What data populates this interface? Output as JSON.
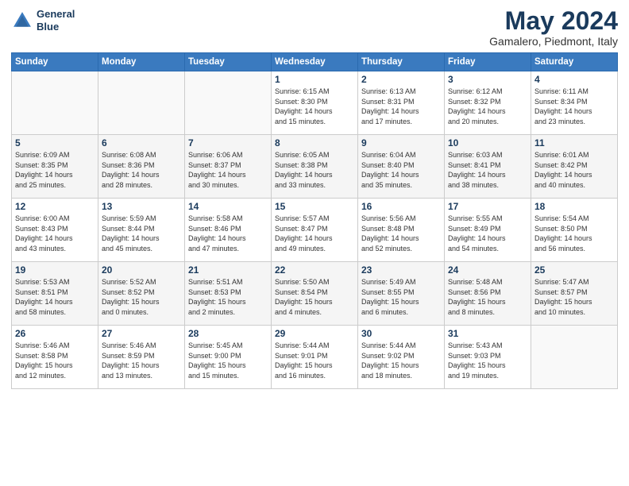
{
  "header": {
    "logo_line1": "General",
    "logo_line2": "Blue",
    "month_title": "May 2024",
    "subtitle": "Gamalero, Piedmont, Italy"
  },
  "weekdays": [
    "Sunday",
    "Monday",
    "Tuesday",
    "Wednesday",
    "Thursday",
    "Friday",
    "Saturday"
  ],
  "weeks": [
    [
      {
        "day": "",
        "info": ""
      },
      {
        "day": "",
        "info": ""
      },
      {
        "day": "",
        "info": ""
      },
      {
        "day": "1",
        "info": "Sunrise: 6:15 AM\nSunset: 8:30 PM\nDaylight: 14 hours\nand 15 minutes."
      },
      {
        "day": "2",
        "info": "Sunrise: 6:13 AM\nSunset: 8:31 PM\nDaylight: 14 hours\nand 17 minutes."
      },
      {
        "day": "3",
        "info": "Sunrise: 6:12 AM\nSunset: 8:32 PM\nDaylight: 14 hours\nand 20 minutes."
      },
      {
        "day": "4",
        "info": "Sunrise: 6:11 AM\nSunset: 8:34 PM\nDaylight: 14 hours\nand 23 minutes."
      }
    ],
    [
      {
        "day": "5",
        "info": "Sunrise: 6:09 AM\nSunset: 8:35 PM\nDaylight: 14 hours\nand 25 minutes."
      },
      {
        "day": "6",
        "info": "Sunrise: 6:08 AM\nSunset: 8:36 PM\nDaylight: 14 hours\nand 28 minutes."
      },
      {
        "day": "7",
        "info": "Sunrise: 6:06 AM\nSunset: 8:37 PM\nDaylight: 14 hours\nand 30 minutes."
      },
      {
        "day": "8",
        "info": "Sunrise: 6:05 AM\nSunset: 8:38 PM\nDaylight: 14 hours\nand 33 minutes."
      },
      {
        "day": "9",
        "info": "Sunrise: 6:04 AM\nSunset: 8:40 PM\nDaylight: 14 hours\nand 35 minutes."
      },
      {
        "day": "10",
        "info": "Sunrise: 6:03 AM\nSunset: 8:41 PM\nDaylight: 14 hours\nand 38 minutes."
      },
      {
        "day": "11",
        "info": "Sunrise: 6:01 AM\nSunset: 8:42 PM\nDaylight: 14 hours\nand 40 minutes."
      }
    ],
    [
      {
        "day": "12",
        "info": "Sunrise: 6:00 AM\nSunset: 8:43 PM\nDaylight: 14 hours\nand 43 minutes."
      },
      {
        "day": "13",
        "info": "Sunrise: 5:59 AM\nSunset: 8:44 PM\nDaylight: 14 hours\nand 45 minutes."
      },
      {
        "day": "14",
        "info": "Sunrise: 5:58 AM\nSunset: 8:46 PM\nDaylight: 14 hours\nand 47 minutes."
      },
      {
        "day": "15",
        "info": "Sunrise: 5:57 AM\nSunset: 8:47 PM\nDaylight: 14 hours\nand 49 minutes."
      },
      {
        "day": "16",
        "info": "Sunrise: 5:56 AM\nSunset: 8:48 PM\nDaylight: 14 hours\nand 52 minutes."
      },
      {
        "day": "17",
        "info": "Sunrise: 5:55 AM\nSunset: 8:49 PM\nDaylight: 14 hours\nand 54 minutes."
      },
      {
        "day": "18",
        "info": "Sunrise: 5:54 AM\nSunset: 8:50 PM\nDaylight: 14 hours\nand 56 minutes."
      }
    ],
    [
      {
        "day": "19",
        "info": "Sunrise: 5:53 AM\nSunset: 8:51 PM\nDaylight: 14 hours\nand 58 minutes."
      },
      {
        "day": "20",
        "info": "Sunrise: 5:52 AM\nSunset: 8:52 PM\nDaylight: 15 hours\nand 0 minutes."
      },
      {
        "day": "21",
        "info": "Sunrise: 5:51 AM\nSunset: 8:53 PM\nDaylight: 15 hours\nand 2 minutes."
      },
      {
        "day": "22",
        "info": "Sunrise: 5:50 AM\nSunset: 8:54 PM\nDaylight: 15 hours\nand 4 minutes."
      },
      {
        "day": "23",
        "info": "Sunrise: 5:49 AM\nSunset: 8:55 PM\nDaylight: 15 hours\nand 6 minutes."
      },
      {
        "day": "24",
        "info": "Sunrise: 5:48 AM\nSunset: 8:56 PM\nDaylight: 15 hours\nand 8 minutes."
      },
      {
        "day": "25",
        "info": "Sunrise: 5:47 AM\nSunset: 8:57 PM\nDaylight: 15 hours\nand 10 minutes."
      }
    ],
    [
      {
        "day": "26",
        "info": "Sunrise: 5:46 AM\nSunset: 8:58 PM\nDaylight: 15 hours\nand 12 minutes."
      },
      {
        "day": "27",
        "info": "Sunrise: 5:46 AM\nSunset: 8:59 PM\nDaylight: 15 hours\nand 13 minutes."
      },
      {
        "day": "28",
        "info": "Sunrise: 5:45 AM\nSunset: 9:00 PM\nDaylight: 15 hours\nand 15 minutes."
      },
      {
        "day": "29",
        "info": "Sunrise: 5:44 AM\nSunset: 9:01 PM\nDaylight: 15 hours\nand 16 minutes."
      },
      {
        "day": "30",
        "info": "Sunrise: 5:44 AM\nSunset: 9:02 PM\nDaylight: 15 hours\nand 18 minutes."
      },
      {
        "day": "31",
        "info": "Sunrise: 5:43 AM\nSunset: 9:03 PM\nDaylight: 15 hours\nand 19 minutes."
      },
      {
        "day": "",
        "info": ""
      }
    ]
  ]
}
